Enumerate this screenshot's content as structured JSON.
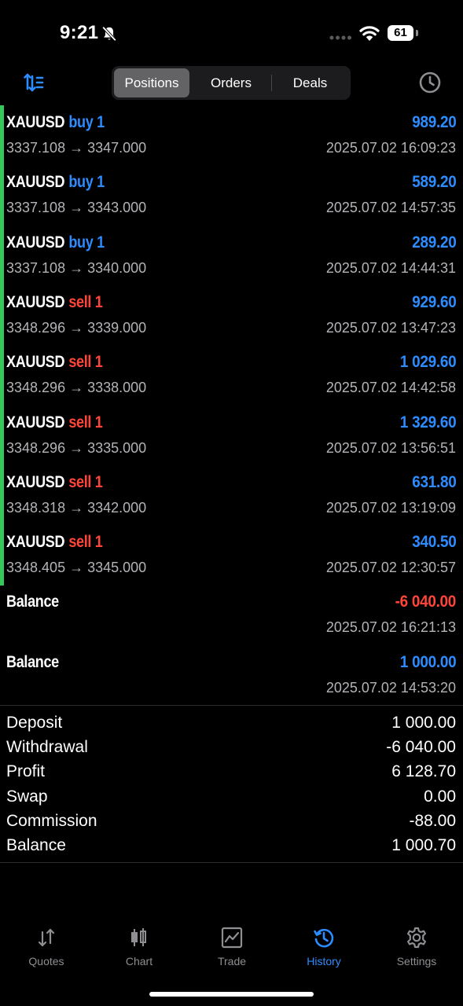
{
  "status_bar": {
    "time": "9:21",
    "battery": "61"
  },
  "segmented": {
    "items": [
      "Positions",
      "Orders",
      "Deals"
    ],
    "selected": "Positions"
  },
  "deals": [
    {
      "symbol": "XAUUSD",
      "side": "buy 1",
      "side_type": "buy",
      "prices": "3337.108 → 3347.000",
      "profit": "989.20",
      "date": "2025.07.02 16:09:23"
    },
    {
      "symbol": "XAUUSD",
      "side": "buy 1",
      "side_type": "buy",
      "prices": "3337.108 → 3343.000",
      "profit": "589.20",
      "date": "2025.07.02 14:57:35"
    },
    {
      "symbol": "XAUUSD",
      "side": "buy 1",
      "side_type": "buy",
      "prices": "3337.108 → 3340.000",
      "profit": "289.20",
      "date": "2025.07.02 14:44:31"
    },
    {
      "symbol": "XAUUSD",
      "side": "sell 1",
      "side_type": "sell",
      "prices": "3348.296 → 3339.000",
      "profit": "929.60",
      "date": "2025.07.02 13:47:23"
    },
    {
      "symbol": "XAUUSD",
      "side": "sell 1",
      "side_type": "sell",
      "prices": "3348.296 → 3338.000",
      "profit": "1 029.60",
      "date": "2025.07.02 14:42:58"
    },
    {
      "symbol": "XAUUSD",
      "side": "sell 1",
      "side_type": "sell",
      "prices": "3348.296 → 3335.000",
      "profit": "1 329.60",
      "date": "2025.07.02 13:56:51"
    },
    {
      "symbol": "XAUUSD",
      "side": "sell 1",
      "side_type": "sell",
      "prices": "3348.318 → 3342.000",
      "profit": "631.80",
      "date": "2025.07.02 13:19:09"
    },
    {
      "symbol": "XAUUSD",
      "side": "sell 1",
      "side_type": "sell",
      "prices": "3348.405 → 3345.000",
      "profit": "340.50",
      "date": "2025.07.02 12:30:57"
    }
  ],
  "balances": [
    {
      "label": "Balance",
      "amount": "-6 040.00",
      "negative": true,
      "date": "2025.07.02 16:21:13"
    },
    {
      "label": "Balance",
      "amount": "1 000.00",
      "negative": false,
      "date": "2025.07.02 14:53:20"
    }
  ],
  "summary": [
    {
      "label": "Deposit",
      "value": "1 000.00"
    },
    {
      "label": "Withdrawal",
      "value": "-6 040.00"
    },
    {
      "label": "Profit",
      "value": "6 128.70"
    },
    {
      "label": "Swap",
      "value": "0.00"
    },
    {
      "label": "Commission",
      "value": "-88.00"
    },
    {
      "label": "Balance",
      "value": "1 000.70"
    }
  ],
  "tabs": [
    {
      "label": "Quotes",
      "icon": "quotes-icon"
    },
    {
      "label": "Chart",
      "icon": "chart-icon"
    },
    {
      "label": "Trade",
      "icon": "trade-icon"
    },
    {
      "label": "History",
      "icon": "history-icon"
    },
    {
      "label": "Settings",
      "icon": "settings-icon"
    }
  ],
  "active_tab": "History",
  "colors": {
    "buy": "#2d8cff",
    "sell": "#ff453a",
    "accent": "#2d8cff",
    "indicator": "#34c759"
  }
}
